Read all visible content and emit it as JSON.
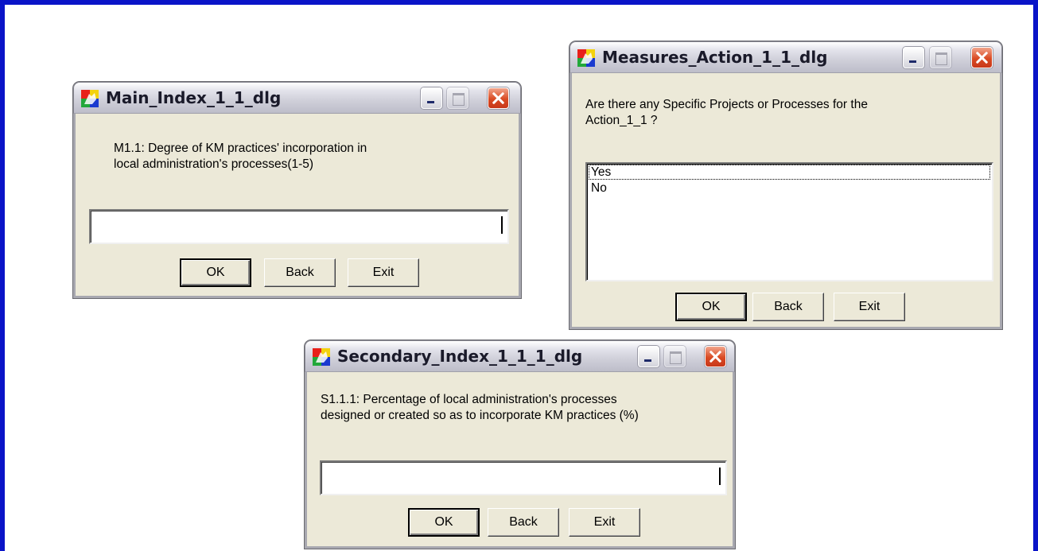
{
  "dialogs": {
    "main": {
      "title": "Main_Index_1_1_dlg",
      "prompt": "M1.1: Degree of KM practices' incorporation in\nlocal administration's processes(1-5)",
      "input_value": "",
      "ok_label": "OK",
      "back_label": "Back",
      "exit_label": "Exit"
    },
    "measures": {
      "title": "Measures_Action_1_1_dlg",
      "prompt": "Are there any Specific Projects or Processes for the\nAction_1_1 ?",
      "list_items": [
        "Yes",
        "No"
      ],
      "ok_label": "OK",
      "back_label": "Back",
      "exit_label": "Exit"
    },
    "secondary": {
      "title": "Secondary_Index_1_1_1_dlg",
      "prompt": "S1.1.1: Percentage of local administration's processes\ndesigned or created so as to incorporate KM practices (%)",
      "input_value": "",
      "ok_label": "OK",
      "back_label": "Back",
      "exit_label": "Exit"
    }
  },
  "colors": {
    "frame_border": "#0a14c8",
    "dialog_face": "#ece9d8",
    "close_button": "#d94a23"
  },
  "icons": {
    "app": "app-icon",
    "minimize": "minimize-icon",
    "maximize": "maximize-icon",
    "close": "close-icon"
  }
}
